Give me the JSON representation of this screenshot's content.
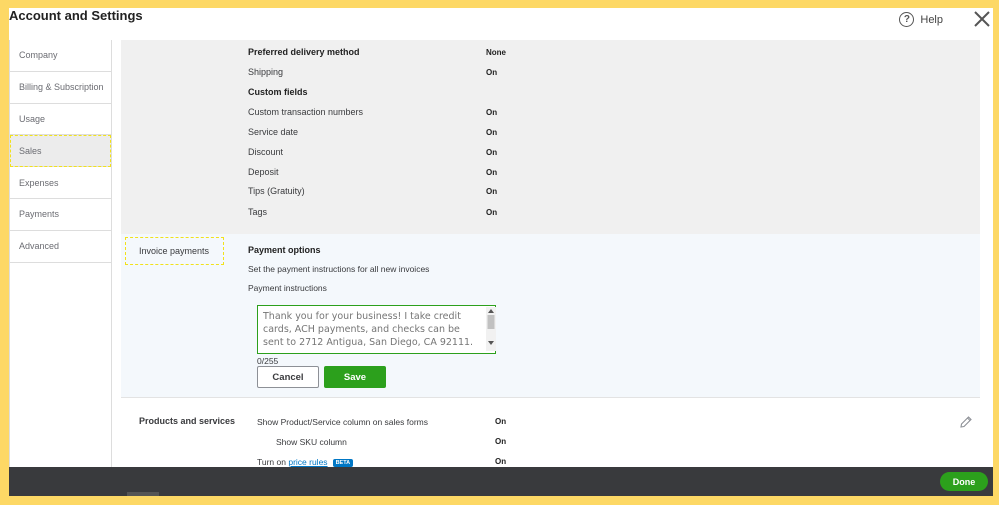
{
  "window": {
    "title": "Account and Settings",
    "help_label": "Help"
  },
  "sidebar": {
    "items": [
      {
        "label": "Company"
      },
      {
        "label": "Billing & Subscription"
      },
      {
        "label": "Usage"
      },
      {
        "label": "Sales"
      },
      {
        "label": "Expenses"
      },
      {
        "label": "Payments"
      },
      {
        "label": "Advanced"
      }
    ],
    "active": "Sales"
  },
  "sales_form": {
    "rows": [
      {
        "label": "Preferred delivery method",
        "value": "None",
        "bold": true
      },
      {
        "label": "Shipping",
        "value": "On"
      },
      {
        "label": "Custom fields",
        "value": "",
        "bold": true
      },
      {
        "label": "Custom transaction numbers",
        "value": "On"
      },
      {
        "label": "Service date",
        "value": "On"
      },
      {
        "label": "Discount",
        "value": "On"
      },
      {
        "label": "Deposit",
        "value": "On"
      },
      {
        "label": "Tips (Gratuity)",
        "value": "On"
      },
      {
        "label": "Tags",
        "value": "On"
      }
    ]
  },
  "invoice_payments": {
    "section_label": "Invoice payments",
    "heading": "Payment options",
    "description": "Set the payment instructions for all new invoices",
    "field_label": "Payment instructions",
    "placeholder": "Thank you for your business! I take credit cards, ACH payments, and checks can be sent to 2712 Antigua, San Diego, CA 92111.",
    "counter": "0/255",
    "cancel_label": "Cancel",
    "save_label": "Save"
  },
  "products_services": {
    "section_label": "Products and services",
    "rows": [
      {
        "label": "Show Product/Service column on sales forms",
        "value": "On"
      },
      {
        "label": "Show SKU column",
        "value": "On"
      },
      {
        "label_prefix": "Turn on ",
        "link": "price rules",
        "badge": "BETA",
        "value": "On"
      }
    ]
  },
  "footer": {
    "done_label": "Done"
  },
  "colors": {
    "accent_green": "#2ca01c",
    "link_blue": "#0077c5",
    "highlight_yellow": "#fdd865"
  }
}
